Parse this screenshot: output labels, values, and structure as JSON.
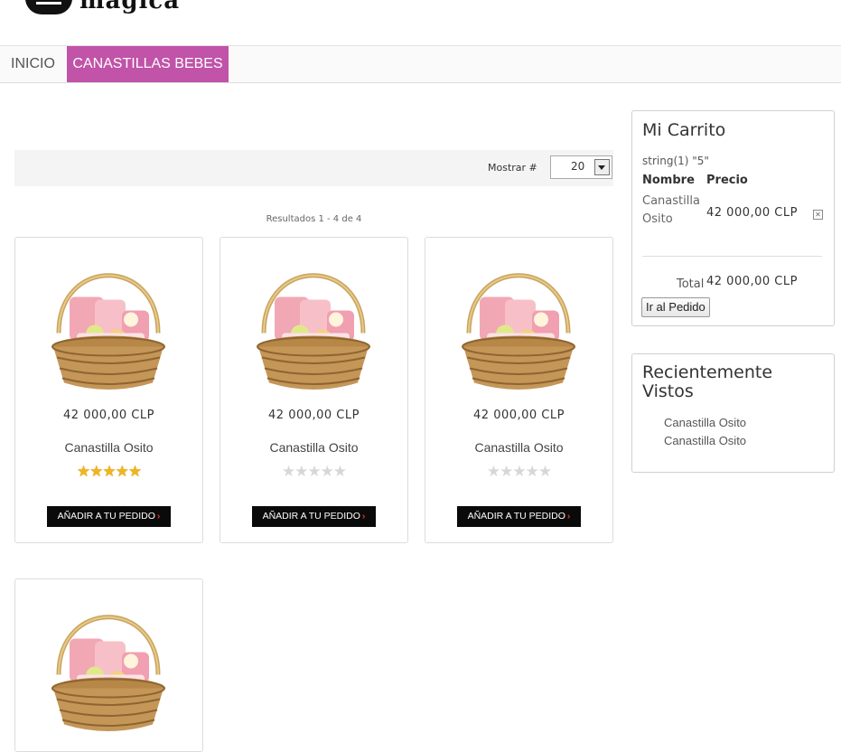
{
  "header": {
    "logo_text": "mágica"
  },
  "nav": {
    "items": [
      {
        "label": "INICIO"
      },
      {
        "label": "CANASTILLAS BEBES"
      }
    ]
  },
  "toolbar": {
    "show_label": "Mostrar #",
    "show_value": "20"
  },
  "results_text": "Resultados 1 - 4 de 4",
  "products": [
    {
      "price": "42 000,00 CLP",
      "name": "Canastilla Osito",
      "rating": 5,
      "button": "AÑADIR A TU PEDIDO"
    },
    {
      "price": "42 000,00 CLP",
      "name": "Canastilla Osito",
      "rating": 0,
      "button": "AÑADIR A TU PEDIDO"
    },
    {
      "price": "42 000,00 CLP",
      "name": "Canastilla Osito",
      "rating": 0,
      "button": "AÑADIR A TU PEDIDO"
    },
    {
      "price": "",
      "name": "",
      "rating": null,
      "button": ""
    }
  ],
  "cart": {
    "title": "Mi Carrito",
    "debug_text": "string(1) \"5\"",
    "col_name": "Nombre",
    "col_price": "Precio",
    "item_name": "Canastilla Osito",
    "item_price": "42 000,00 CLP",
    "total_label": "Total",
    "total_value": "42 000,00 CLP",
    "button": "Ir al Pedido"
  },
  "recent": {
    "title": "Recientemente Vistos",
    "items": [
      "Canastilla Osito",
      "Canastilla Osito"
    ]
  },
  "colors": {
    "nav_active": "#c153a8",
    "button_bg": "#0a0a0a",
    "star_on": "#f2b41a",
    "star_off": "#d7d7d7"
  }
}
